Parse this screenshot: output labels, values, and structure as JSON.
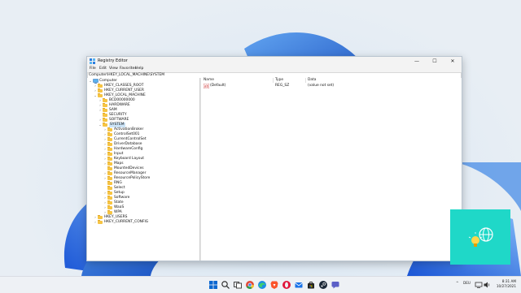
{
  "window": {
    "title": "Registry Editor",
    "controls": {
      "minimize": "—",
      "maximize": "☐",
      "close": "✕"
    }
  },
  "menu": [
    "File",
    "Edit",
    "View",
    "Favorites",
    "Help"
  ],
  "address": "Computer\\HKEY_LOCAL_MACHINE\\SYSTEM",
  "tree": [
    {
      "label": "Computer",
      "chev": "⌄",
      "icon": "computer-icon"
    },
    {
      "label": "HKEY_CLASSES_ROOT",
      "chev": "›"
    },
    {
      "label": "HKEY_CURRENT_USER",
      "chev": "›"
    },
    {
      "label": "HKEY_LOCAL_MACHINE",
      "chev": "⌄"
    },
    {
      "label": "BCD00000000",
      "chev": "›"
    },
    {
      "label": "HARDWARE",
      "chev": "›"
    },
    {
      "label": "SAM",
      "chev": "›"
    },
    {
      "label": "SECURITY",
      "chev": ""
    },
    {
      "label": "SOFTWARE",
      "chev": "›"
    },
    {
      "label": "SYSTEM",
      "chev": "⌄",
      "selected": true
    },
    {
      "label": "ActivationBroker",
      "chev": "›"
    },
    {
      "label": "ControlSet001",
      "chev": "›"
    },
    {
      "label": "CurrentControlSet",
      "chev": "›"
    },
    {
      "label": "DriverDatabase",
      "chev": "›"
    },
    {
      "label": "HardwareConfig",
      "chev": "›"
    },
    {
      "label": "Input",
      "chev": "›"
    },
    {
      "label": "Keyboard Layout",
      "chev": "›"
    },
    {
      "label": "Maps",
      "chev": "›"
    },
    {
      "label": "MountedDevices",
      "chev": ""
    },
    {
      "label": "ResourceManager",
      "chev": "›"
    },
    {
      "label": "ResourcePolicyStore",
      "chev": "›"
    },
    {
      "label": "RNG",
      "chev": ""
    },
    {
      "label": "Select",
      "chev": ""
    },
    {
      "label": "Setup",
      "chev": "›"
    },
    {
      "label": "Software",
      "chev": "›"
    },
    {
      "label": "State",
      "chev": "›"
    },
    {
      "label": "WaaS",
      "chev": "›"
    },
    {
      "label": "WPA",
      "chev": "›"
    },
    {
      "label": "HKEY_USERS",
      "chev": "›"
    },
    {
      "label": "HKEY_CURRENT_CONFIG",
      "chev": "›"
    }
  ],
  "columns": {
    "name": "Name",
    "type": "Type",
    "data": "Data"
  },
  "values": [
    {
      "name": "(Default)",
      "type": "REG_SZ",
      "data": "(value not set)"
    }
  ],
  "taskbar": {
    "icons": [
      "windows-start-icon",
      "search-icon",
      "task-view-icon",
      "chrome-icon",
      "edge-icon",
      "brave-icon",
      "opera-icon",
      "mail-icon",
      "store-icon",
      "steam-icon",
      "chat-icon"
    ],
    "tray_caret": "^",
    "language": "DEU",
    "time": "8:31 AM",
    "date": "10/27/2021"
  },
  "popup": {
    "color": "#1fd8c8"
  },
  "colors": {
    "selection": "#cce4f7",
    "folder": "#f6c443",
    "accent": "#0067c0"
  }
}
